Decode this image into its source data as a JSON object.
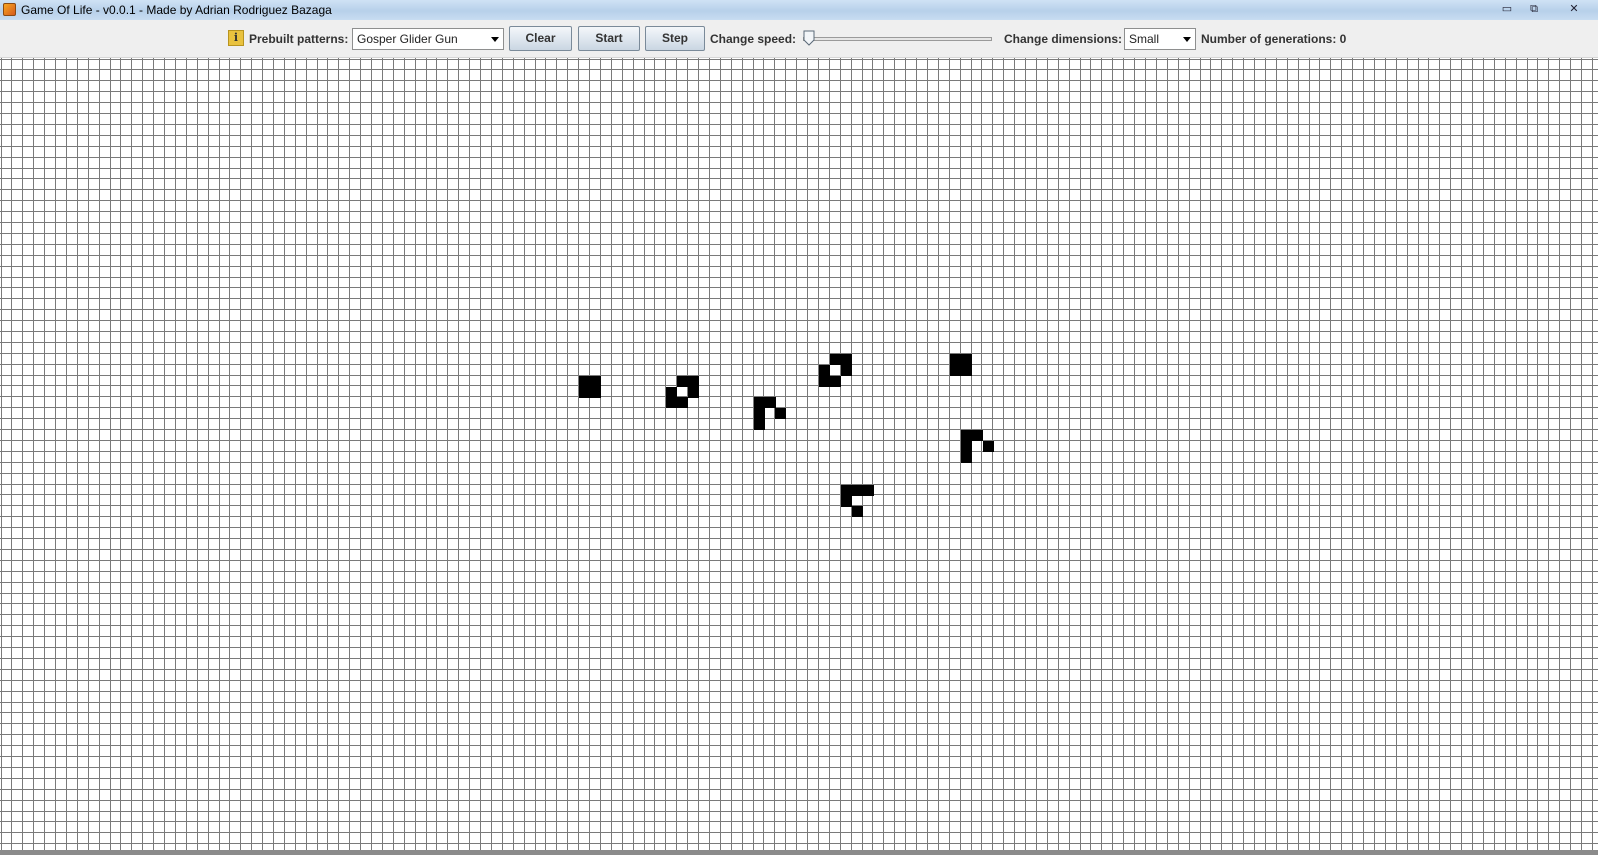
{
  "window": {
    "title": "Game Of Life - v0.0.1 - Made by Adrian Rodriguez Bazaga",
    "minimize_glyph": "▭",
    "maximize_glyph": "⧉",
    "close_glyph": "✕"
  },
  "toolbar": {
    "info_glyph": "i",
    "patterns_label": "Prebuilt patterns:",
    "patterns_value": "Gosper Glider Gun",
    "clear_label": "Clear",
    "start_label": "Start",
    "step_label": "Step",
    "speed_label": "Change speed:",
    "speed_value": 0,
    "dimensions_label": "Change dimensions:",
    "dimensions_value": "Small",
    "generations_label": "Number of generations: 0"
  },
  "grid": {
    "live_cells": [
      [
        53,
        29
      ],
      [
        54,
        29
      ],
      [
        53,
        30
      ],
      [
        54,
        30
      ],
      [
        62,
        29
      ],
      [
        63,
        29
      ],
      [
        61,
        30
      ],
      [
        63,
        30
      ],
      [
        61,
        31
      ],
      [
        62,
        31
      ],
      [
        69,
        31
      ],
      [
        70,
        31
      ],
      [
        69,
        32
      ],
      [
        71,
        32
      ],
      [
        69,
        33
      ],
      [
        76,
        27
      ],
      [
        77,
        27
      ],
      [
        75,
        28
      ],
      [
        77,
        28
      ],
      [
        75,
        29
      ],
      [
        76,
        29
      ],
      [
        77,
        39
      ],
      [
        78,
        39
      ],
      [
        79,
        39
      ],
      [
        77,
        40
      ],
      [
        78,
        41
      ],
      [
        87,
        27
      ],
      [
        88,
        27
      ],
      [
        87,
        28
      ],
      [
        88,
        28
      ],
      [
        88,
        34
      ],
      [
        89,
        34
      ],
      [
        88,
        35
      ],
      [
        90,
        35
      ],
      [
        88,
        36
      ]
    ],
    "cell_color": "#000000",
    "line_color": "#7a7a7a"
  }
}
